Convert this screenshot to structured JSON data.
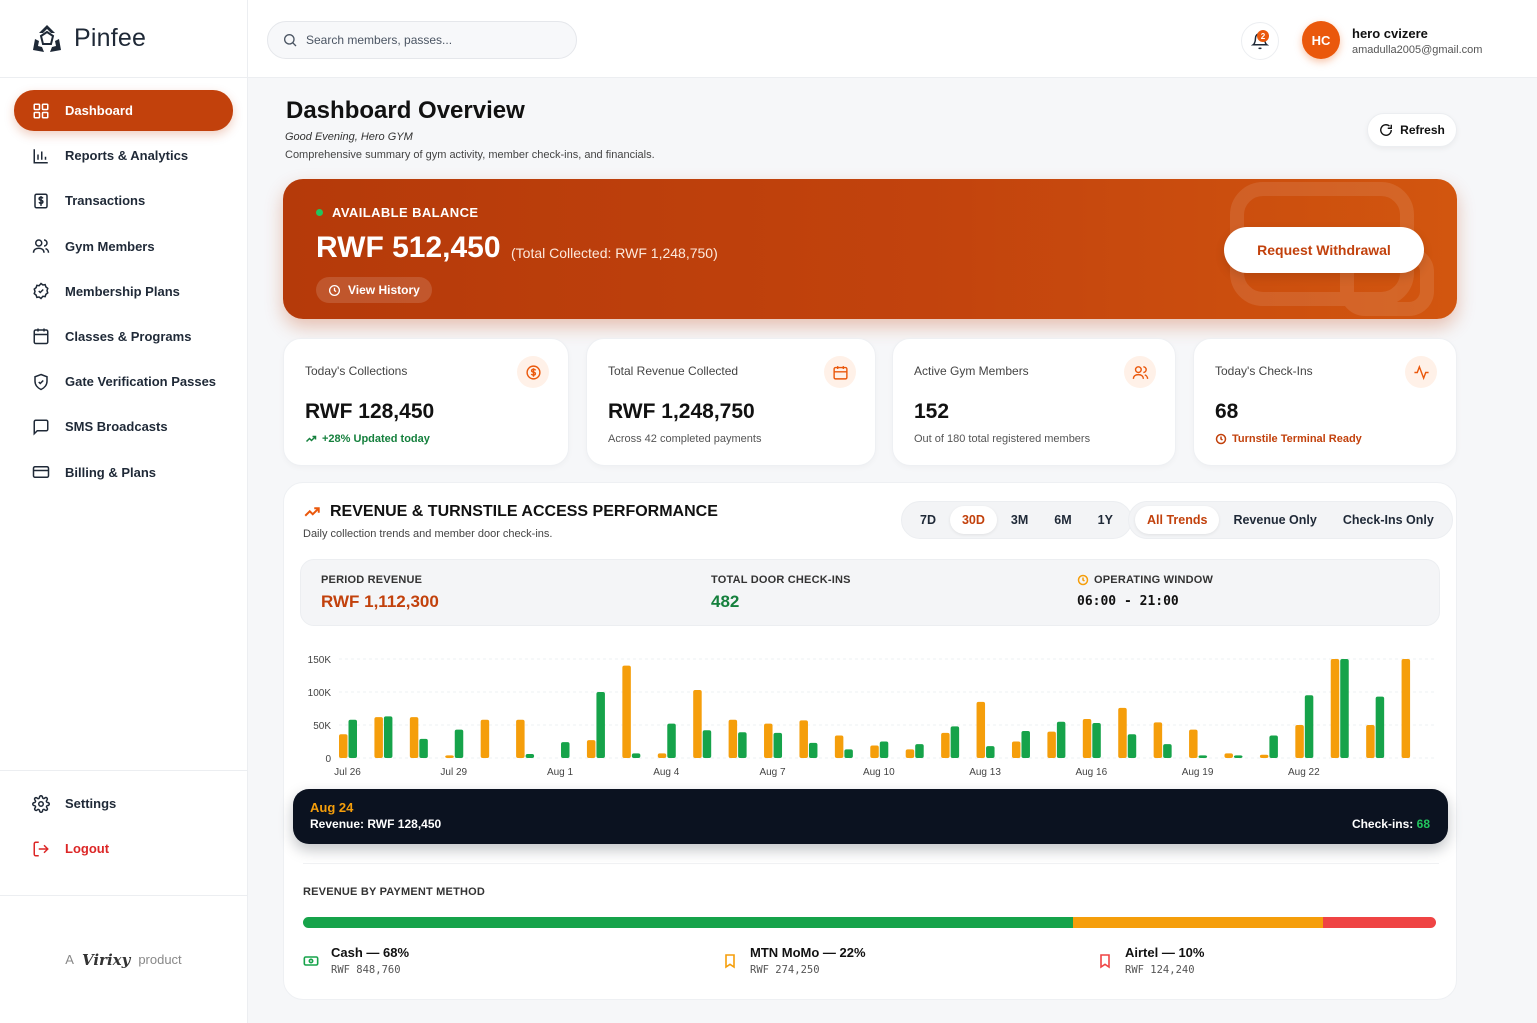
{
  "brand": {
    "name": "Pinfee"
  },
  "sidebar": {
    "items": [
      {
        "label": "Dashboard",
        "icon": "grid-icon",
        "active": true
      },
      {
        "label": "Reports & Analytics",
        "icon": "bar-chart-icon"
      },
      {
        "label": "Transactions",
        "icon": "dollar-receipt-icon"
      },
      {
        "label": "Gym Members",
        "icon": "users-icon"
      },
      {
        "label": "Membership Plans",
        "icon": "badge-icon"
      },
      {
        "label": "Classes & Programs",
        "icon": "calendar-icon"
      },
      {
        "label": "Gate Verification Passes",
        "icon": "shield-check-icon"
      },
      {
        "label": "SMS Broadcasts",
        "icon": "message-icon"
      },
      {
        "label": "Billing & Plans",
        "icon": "card-icon"
      }
    ],
    "settings_label": "Settings",
    "logout_label": "Logout",
    "footer": {
      "prefix": "A",
      "company": "Virixy",
      "suffix": "product"
    }
  },
  "topbar": {
    "search_placeholder": "Search members, passes...",
    "notification_count": "2",
    "user": {
      "initials": "HC",
      "name": "hero cvizere",
      "email": "amadulla2005@gmail.com"
    }
  },
  "header": {
    "title": "Dashboard Overview",
    "greeting": "Good Evening, Hero GYM",
    "subtitle": "Comprehensive summary of gym activity, member check-ins, and financials.",
    "refresh_label": "Refresh"
  },
  "balance": {
    "label": "AVAILABLE BALANCE",
    "amount": "RWF 512,450",
    "total": "(Total Collected: RWF 1,248,750)",
    "history_label": "View History",
    "withdraw_label": "Request Withdrawal"
  },
  "stats": [
    {
      "label": "Today's Collections",
      "value": "RWF 128,450",
      "sub": "+28% Updated today",
      "icon": "dollar-circle-icon"
    },
    {
      "label": "Total Revenue Collected",
      "value": "RWF 1,248,750",
      "sub": "Across 42 completed payments",
      "icon": "calendar-icon"
    },
    {
      "label": "Active Gym Members",
      "value": "152",
      "sub": "Out of 180 total registered members",
      "icon": "users-icon"
    },
    {
      "label": "Today's Check-Ins",
      "value": "68",
      "sub": "Turnstile Terminal Ready",
      "icon": "activity-icon"
    }
  ],
  "performance": {
    "title": "REVENUE & TURNSTILE ACCESS PERFORMANCE",
    "subtitle": "Daily collection trends and member door check-ins.",
    "ranges": [
      "7D",
      "30D",
      "3M",
      "6M",
      "1Y"
    ],
    "active_range": "30D",
    "views": [
      "All Trends",
      "Revenue Only",
      "Check-Ins Only"
    ],
    "active_view": "All Trends",
    "period_revenue_label": "PERIOD REVENUE",
    "period_revenue": "RWF 1,112,300",
    "checkins_label": "TOTAL DOOR CHECK-INS",
    "checkins": "482",
    "window_label": "OPERATING WINDOW",
    "window": "06:00 - 21:00",
    "tooltip": {
      "date": "Aug 24",
      "revenue": "Revenue: RWF 128,450",
      "checkins_label": "Check-ins:",
      "checkins": "68"
    }
  },
  "chart_data": {
    "type": "bar",
    "ylim": [
      0,
      150000
    ],
    "y_ticks": [
      "0",
      "50K",
      "100K",
      "150K"
    ],
    "x_tick_labels": [
      "Jul 26",
      "Jul 29",
      "Aug 1",
      "Aug 4",
      "Aug 7",
      "Aug 10",
      "Aug 13",
      "Aug 16",
      "Aug 19",
      "Aug 22"
    ],
    "x_tick_index": [
      0,
      3,
      6,
      9,
      12,
      15,
      18,
      21,
      24,
      27
    ],
    "series": [
      {
        "colour": "#f59e0b",
        "values": [
          36000,
          62000,
          62000,
          4000,
          58000,
          58000,
          0,
          27000,
          140000,
          7000,
          103000,
          58000,
          52000,
          57000,
          34000,
          19000,
          13000,
          38000,
          85000,
          25000,
          40000,
          59000,
          76000,
          54000,
          43000,
          7000,
          5000,
          50000,
          150000,
          50000,
          150000
        ]
      },
      {
        "colour": "#16a34a",
        "values": [
          58000,
          63000,
          29000,
          43000,
          0,
          6000,
          24000,
          100000,
          7000,
          52000,
          42000,
          39000,
          38000,
          23000,
          13000,
          25000,
          21000,
          48000,
          18000,
          41000,
          55000,
          53000,
          36000,
          21000,
          4000,
          4000,
          34000,
          95000,
          150000,
          93000
        ]
      }
    ]
  },
  "payment_methods": {
    "title": "REVENUE BY PAYMENT METHOD",
    "methods": [
      {
        "name": "Cash — 68%",
        "amount": "RWF 848,760",
        "share": 0.68,
        "colour": "#16a34a",
        "icon": "cash-icon"
      },
      {
        "name": "MTN MoMo — 22%",
        "amount": "RWF 274,250",
        "share": 0.22,
        "colour": "#f59e0b",
        "icon": "bookmark-icon"
      },
      {
        "name": "Airtel — 10%",
        "amount": "RWF 124,240",
        "share": 0.1,
        "colour": "#ef4444",
        "icon": "bookmark-icon"
      }
    ]
  }
}
